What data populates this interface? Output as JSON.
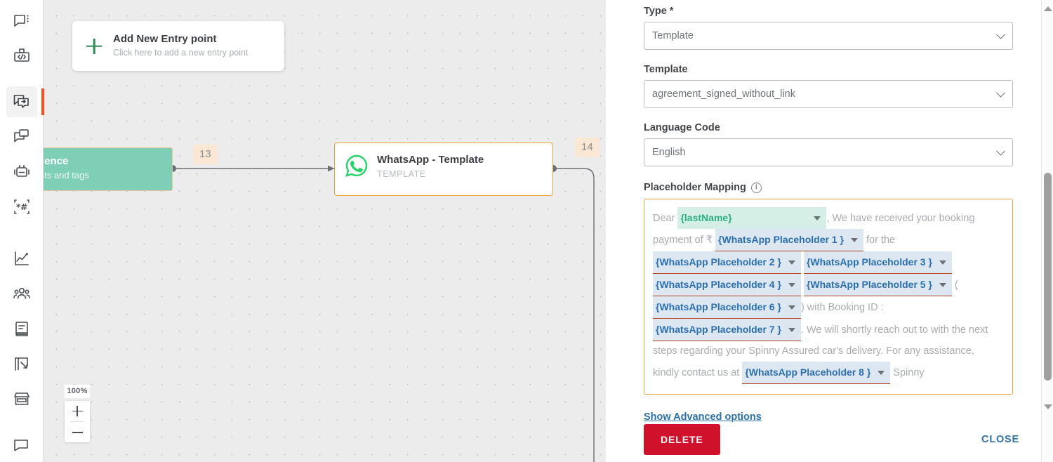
{
  "rail": {
    "groups": [
      {
        "items": [
          {
            "name": "chat-icon",
            "label": "Conversations"
          },
          {
            "name": "code-box-icon",
            "label": "Developer"
          }
        ]
      },
      {
        "items": [
          {
            "name": "journey-icon",
            "label": "Journeys",
            "active": true
          },
          {
            "name": "campaign-icon",
            "label": "Campaigns"
          },
          {
            "name": "bot-icon",
            "label": "Bots"
          },
          {
            "name": "template-icon",
            "label": "Templates"
          }
        ]
      },
      {
        "items": [
          {
            "name": "analytics-icon",
            "label": "Analytics"
          },
          {
            "name": "audience-icon",
            "label": "Audience"
          },
          {
            "name": "catalog-icon",
            "label": "Catalog"
          },
          {
            "name": "forms-icon",
            "label": "Forms"
          },
          {
            "name": "store-icon",
            "label": "Store"
          }
        ]
      }
    ]
  },
  "canvas": {
    "entry_node": {
      "title": "Add New Entry point",
      "subtitle": "Click here to add a new entry point",
      "plus_color": "#2e8b57"
    },
    "audience_node": {
      "title": "d Audience",
      "subtitle": "segments and tags",
      "badge": "13",
      "fill_color": "#7fcfb6"
    },
    "whatsapp_node": {
      "title": "WhatsApp - Template",
      "subtitle": "TEMPLATE",
      "badge": "14",
      "border_color": "#e8a33d",
      "icon": "whatsapp-icon"
    },
    "zoom": {
      "level": "100%",
      "zoom_in": "+",
      "zoom_out": "−"
    }
  },
  "panel": {
    "fields": {
      "type_label": "Type *",
      "type_value": "Template",
      "template_label": "Template",
      "template_value": "agreement_signed_without_link",
      "language_label": "Language Code",
      "language_value": "English"
    },
    "placeholder_mapping": {
      "heading": "Placeholder Mapping",
      "info_icon": "info-icon",
      "tokens": [
        {
          "kind": "text",
          "value": "Dear "
        },
        {
          "kind": "chip",
          "value": "{lastName}",
          "style": "green"
        },
        {
          "kind": "text",
          "value": ", We have received your booking payment of ₹ "
        },
        {
          "kind": "chip",
          "value": "{WhatsApp Placeholder 1 }",
          "style": "blue"
        },
        {
          "kind": "text",
          "value": " for the "
        },
        {
          "kind": "chip",
          "value": "{WhatsApp Placeholder 2 }",
          "style": "blue"
        },
        {
          "kind": "text",
          "value": " "
        },
        {
          "kind": "chip",
          "value": "{WhatsApp Placeholder 3 }",
          "style": "blue"
        },
        {
          "kind": "text",
          "value": " "
        },
        {
          "kind": "chip",
          "value": "{WhatsApp Placeholder 4 }",
          "style": "blue"
        },
        {
          "kind": "text",
          "value": " "
        },
        {
          "kind": "chip",
          "value": "{WhatsApp Placeholder 5 }",
          "style": "blue"
        },
        {
          "kind": "text",
          "value": " ( "
        },
        {
          "kind": "chip",
          "value": "{WhatsApp Placeholder 6 }",
          "style": "blue"
        },
        {
          "kind": "text",
          "value": ") with Booking ID : "
        },
        {
          "kind": "chip",
          "value": "{WhatsApp Placeholder 7 }",
          "style": "blue"
        },
        {
          "kind": "text",
          "value": ". We will shortly reach out to with the next steps regarding your Spinny Assured car's delivery. For any assistance, kindly contact us at "
        },
        {
          "kind": "chip",
          "value": "{WhatsApp Placeholder 8 }",
          "style": "blue"
        },
        {
          "kind": "text",
          "value": " Spinny"
        }
      ]
    },
    "advanced_link": "Show Advanced options",
    "delete_button": "DELETE",
    "close_button": "CLOSE",
    "colors": {
      "delete_red": "#d0112b",
      "link_blue": "#2d71a8",
      "accent_orange": "#e8a33d",
      "chip_green": "#2bb181",
      "chip_blue": "#2a6fb0"
    }
  },
  "scrollbar": {
    "up_arrow": "scroll-up-arrow",
    "down_arrow": "scroll-down-arrow",
    "thumb": "scroll-thumb"
  }
}
